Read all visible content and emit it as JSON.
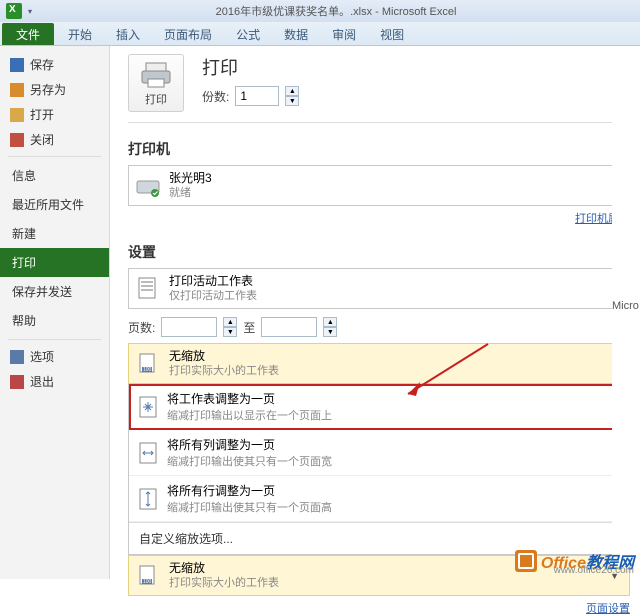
{
  "app": {
    "title": "2016年市级优课获奖名单。.xlsx - Microsoft Excel"
  },
  "ribbon": {
    "file": "文件",
    "home": "开始",
    "insert": "插入",
    "layout": "页面布局",
    "formula": "公式",
    "data": "数据",
    "review": "审阅",
    "view": "视图"
  },
  "nav": {
    "save": "保存",
    "saveAs": "另存为",
    "open": "打开",
    "close": "关闭",
    "info": "信息",
    "recent": "最近所用文件",
    "new": "新建",
    "print": "打印",
    "saveSend": "保存并发送",
    "help": "帮助",
    "options": "选项",
    "exit": "退出"
  },
  "print": {
    "heading": "打印",
    "button": "打印",
    "copiesLabel": "份数:",
    "copiesValue": "1",
    "printerLabel": "打印机",
    "printerName": "张光明3",
    "printerStatus": "就绪",
    "printerProps": "打印机属性",
    "settingsLabel": "设置",
    "activeTitle": "打印活动工作表",
    "activeSub": "仅打印活动工作表",
    "pagesLabel": "页数:",
    "pagesTo": "至",
    "scale": {
      "none": {
        "title": "无缩放",
        "sub": "打印实际大小的工作表"
      },
      "fitSheet": {
        "title": "将工作表调整为一页",
        "sub": "缩减打印输出以显示在一个页面上"
      },
      "fitCols": {
        "title": "将所有列调整为一页",
        "sub": "缩减打印输出使其只有一个页面宽"
      },
      "fitRows": {
        "title": "将所有行调整为一页",
        "sub": "缩减打印输出使其只有一个页面高"
      },
      "custom": "自定义缩放选项...",
      "current": {
        "title": "无缩放",
        "sub": "打印实际大小的工作表"
      }
    },
    "pageSetup": "页面设置"
  },
  "preview": {
    "edge": "Micro"
  },
  "watermark": {
    "brand1": "Office",
    "brand2": "教程网",
    "url": "www.office26.com"
  }
}
